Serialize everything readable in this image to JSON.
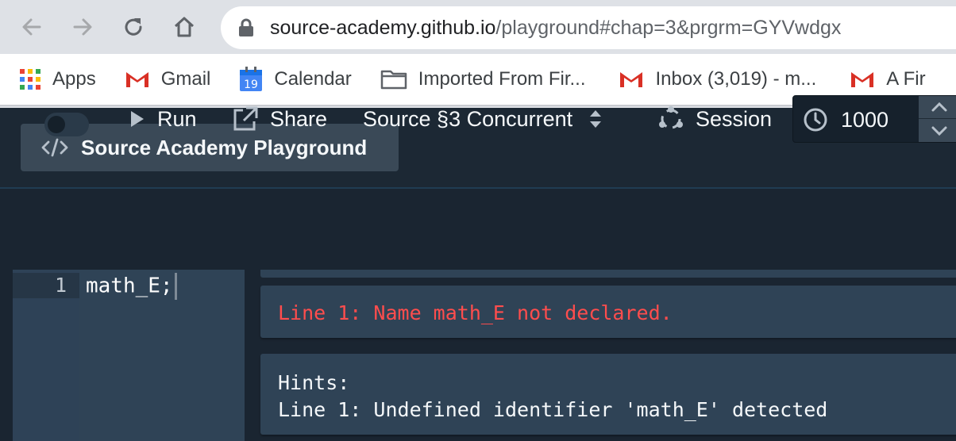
{
  "browser": {
    "url_host": "source-academy.github.io",
    "url_path": "/playground#chap=3&prgrm=GYVwdgx",
    "bookmarks": [
      {
        "label": "Apps",
        "icon": "apps-grid-icon"
      },
      {
        "label": "Gmail",
        "icon": "gmail-icon"
      },
      {
        "label": "Calendar",
        "icon": "calendar-icon",
        "badge": "19"
      },
      {
        "label": "Imported From Fir...",
        "icon": "folder-icon"
      },
      {
        "label": "Inbox (3,019) - m...",
        "icon": "gmail-icon"
      },
      {
        "label": "A Fir",
        "icon": "gmail-icon"
      }
    ]
  },
  "app": {
    "title": "Source Academy Playground"
  },
  "toolbar": {
    "run_label": "Run",
    "share_label": "Share",
    "chapter_label": "Source §3 Concurrent",
    "session_label": "Session",
    "timeout_value": "1000"
  },
  "editor": {
    "line_number": "1",
    "code": "math_E;"
  },
  "repl": {
    "error": "Line 1: Name math_E not declared.",
    "hints_title": "Hints:",
    "hints_line": "Line 1: Undefined identifier 'math_E' detected"
  },
  "colors": {
    "error_text": "#ff4d4d",
    "panel_bg": "#2f4356",
    "app_bg": "#1b2836"
  }
}
